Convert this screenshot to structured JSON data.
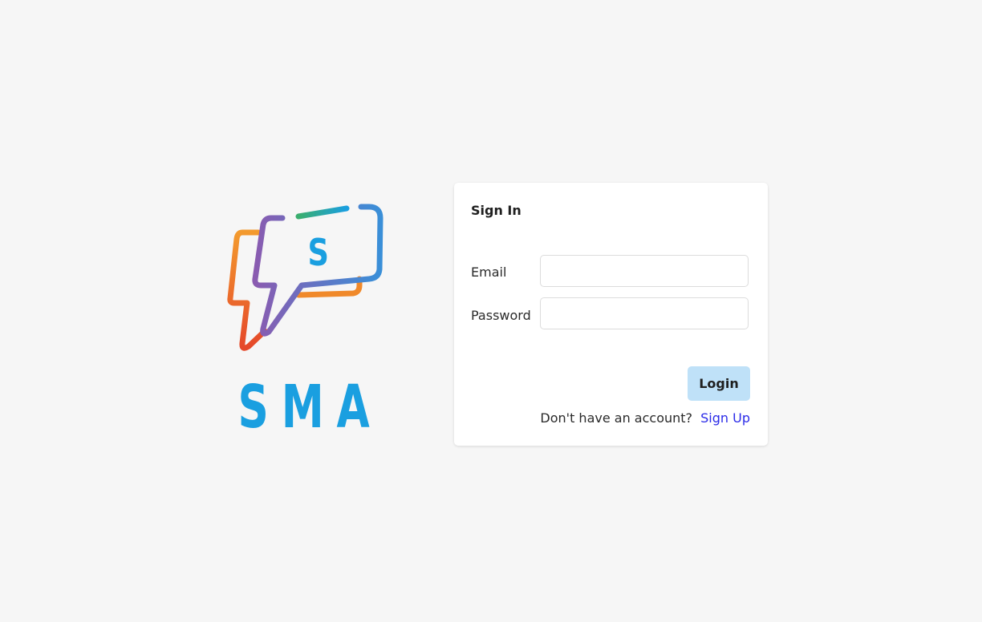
{
  "logo": {
    "badge_letter": "S",
    "wordmark": "SMA",
    "colors": {
      "orange": "#f0892a",
      "red_orange": "#e8542a",
      "purple": "#8a5bb0",
      "green": "#2aa88a",
      "blue": "#1a9fe0",
      "wordmark": "#1a9fe0"
    }
  },
  "signin": {
    "title": "Sign In",
    "email_label": "Email",
    "email_value": "",
    "email_placeholder": "",
    "password_label": "Password",
    "password_value": "",
    "password_placeholder": "",
    "login_label": "Login",
    "no_account_text": "Don't have an account?",
    "signup_label": "Sign Up"
  },
  "colors": {
    "background": "#f6f6f6",
    "card": "#ffffff",
    "login_button": "#bfe1f8",
    "link": "#2b2be8"
  }
}
